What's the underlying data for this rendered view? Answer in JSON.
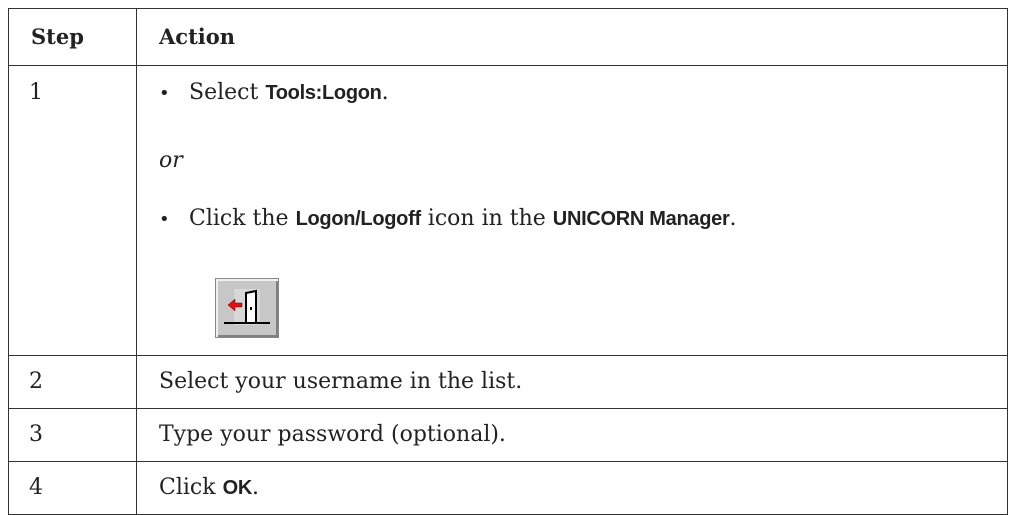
{
  "headers": {
    "step": "Step",
    "action": "Action"
  },
  "row1": {
    "step": "1",
    "bullet": "•",
    "line1_pre": "Select ",
    "line1_kw": "Tools:Logon",
    "line1_post": ".",
    "or": "or",
    "line2_pre": "Click the ",
    "line2_kw1": "Logon/Logoff",
    "line2_mid": " icon in the ",
    "line2_kw2": "UNICORN Manager",
    "line2_post": ".",
    "icon": "logon-logoff-icon"
  },
  "row2": {
    "step": "2",
    "text": "Select your username in the list."
  },
  "row3": {
    "step": "3",
    "text": "Type your password (optional)."
  },
  "row4": {
    "step": "4",
    "text_pre": "Click ",
    "text_kw": "OK",
    "text_post": "."
  },
  "colors": {
    "border": "#333333",
    "icon_bg": "#c7c7c7",
    "arrow": "#e01010"
  }
}
